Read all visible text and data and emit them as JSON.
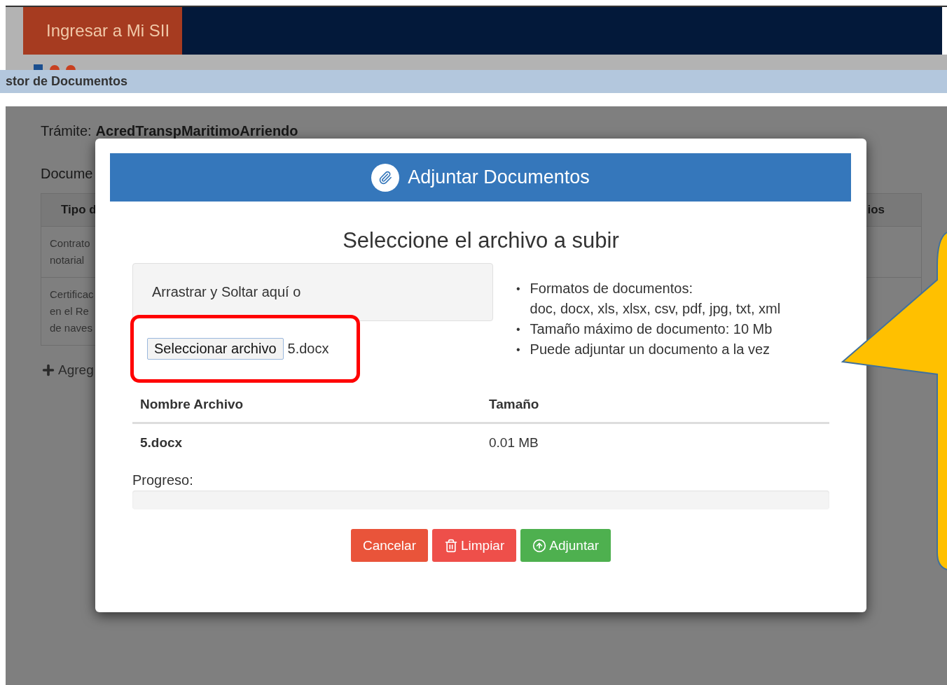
{
  "header": {
    "login_button": "Ingresar a Mi SII"
  },
  "breadcrumb": "stor de Documentos",
  "page": {
    "tramite_label": "Trámite:",
    "tramite_value": "AcredTranspMaritimoArriendo",
    "section_title": "Docume",
    "table": {
      "columns": [
        "Tipo d",
        "ios"
      ],
      "rows": [
        {
          "lines": [
            "Contrato",
            "notarial"
          ]
        },
        {
          "lines": [
            "Certificac",
            "en el Re",
            "de naves"
          ]
        }
      ]
    },
    "add_link": "Agreg"
  },
  "modal": {
    "title": "Adjuntar Documentos",
    "heading": "Seleccione el archivo a subir",
    "dropzone_text": "Arrastrar y Soltar aquí o",
    "file_button": "Seleccionar archivo",
    "file_name": "5.docx",
    "highlighted": true,
    "info_items": [
      {
        "marker": "•",
        "text": "Formatos de documentos:",
        "detail": "doc, docx, xls, xlsx, csv, pdf, jpg, txt, xml"
      },
      {
        "marker": "•",
        "text": "Tamaño máximo de documento: 10 Mb"
      },
      {
        "marker": "•",
        "text": "Puede adjuntar un documento a la vez"
      }
    ],
    "files_table": {
      "columns": [
        "Nombre Archivo",
        "Tamaño"
      ],
      "rows": [
        {
          "name": "5.docx",
          "size": "0.01 MB"
        }
      ]
    },
    "progress_label": "Progreso:",
    "progress": {
      "level": 0
    },
    "buttons": [
      {
        "label": "Cancelar",
        "kind": "cancel"
      },
      {
        "label": "Limpiar",
        "kind": "clear"
      },
      {
        "label": "Adjuntar",
        "kind": "attach"
      }
    ]
  },
  "callout": {
    "kind": "speech"
  }
}
